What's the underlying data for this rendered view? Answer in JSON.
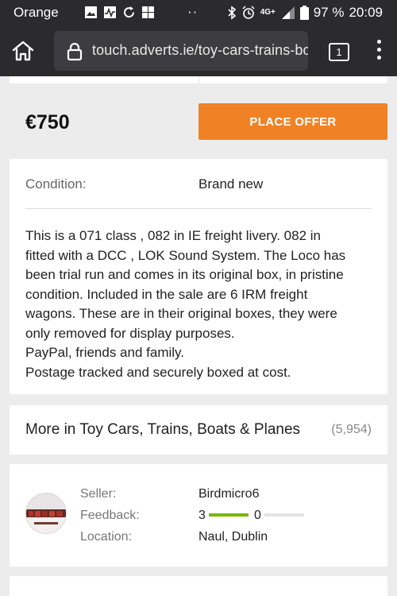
{
  "status_bar": {
    "carrier": "Orange",
    "network": "4G+",
    "battery": "97 %",
    "time": "20:09",
    "icons": [
      "image-icon",
      "activity-icon",
      "sync-icon",
      "windows-icon",
      "bluetooth-icon",
      "alarm-icon",
      "signal-icon",
      "battery-icon"
    ]
  },
  "browser": {
    "url": "touch.adverts.ie/toy-cars-trains-bo",
    "tab_count": "1"
  },
  "listing": {
    "price": "€750",
    "offer_button": "PLACE OFFER",
    "condition_label": "Condition:",
    "condition_value": "Brand new",
    "description_lines": [
      "This is a 071 class , 082 in IE freight livery. 082 in",
      "fitted with a DCC , LOK Sound System. The Loco has",
      "been trial run and comes in its original box, in pristine",
      "condition. Included in the sale are 6 IRM freight",
      "wagons. These are in their original boxes, they were",
      "only removed for display purposes.",
      "PayPal, friends and family.",
      "Postage tracked and securely boxed at cost."
    ]
  },
  "more_in": {
    "label": "More in Toy Cars, Trains, Boats & Planes",
    "count": "(5,954)"
  },
  "seller": {
    "seller_label": "Seller:",
    "seller_name": "Birdmicro6",
    "feedback_label": "Feedback:",
    "positive": "3",
    "negative": "0",
    "location_label": "Location:",
    "location": "Naul, Dublin"
  },
  "colors": {
    "accent": "#f08225",
    "positive_bar": "#7ab800",
    "neutral_bar": "#e4e4e4",
    "topbar": "#2b2b2e"
  }
}
